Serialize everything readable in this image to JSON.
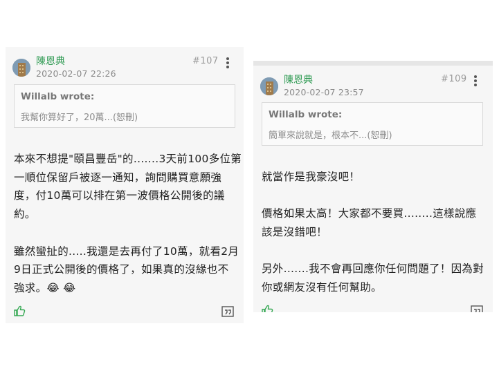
{
  "posts": [
    {
      "author": "陳恩典",
      "date": "2020-02-07 22:26",
      "post_number": "#107",
      "quote_author": "Willalb wrote:",
      "quote_text": "我幫你算好了，20萬...(恕刪)",
      "paragraph1": [
        "本來不想提\"頤昌豐岳\"的.......3天前100多位第",
        "一順位保留戶被逐一通知，詢問購買意願強",
        "度，付10萬可以排在第一波價格公開後的議",
        "約。"
      ],
      "paragraph2": [
        "雖然蠻扯的.....我還是去再付了10萬，就看2月",
        "9日正式公開後的價格了，如果真的沒緣也不",
        "強求。😂 😂"
      ]
    },
    {
      "author": "陳恩典",
      "date": "2020-02-07 23:57",
      "post_number": "#109",
      "quote_author": "Willalb wrote:",
      "quote_text": "簡單來說就是，根本不...(恕刪)",
      "paragraph1": [
        "就當作是我豪沒吧！"
      ],
      "paragraph2": [
        "價格如果太高！大家都不要買........這樣說應",
        "該是沒錯吧！"
      ],
      "paragraph3": [
        "另外.......我不會再回應你任何問題了！因為對",
        "你或網友沒有任何幫助。"
      ]
    }
  ],
  "icons": {
    "like": "thumbs-up-icon",
    "quote": "quote-reply-icon",
    "more": "more-vertical-icon",
    "avatar": "user-avatar"
  },
  "colors": {
    "author": "#2e9a52",
    "like": "#35a853",
    "card_bg": "#f6f6f6"
  }
}
